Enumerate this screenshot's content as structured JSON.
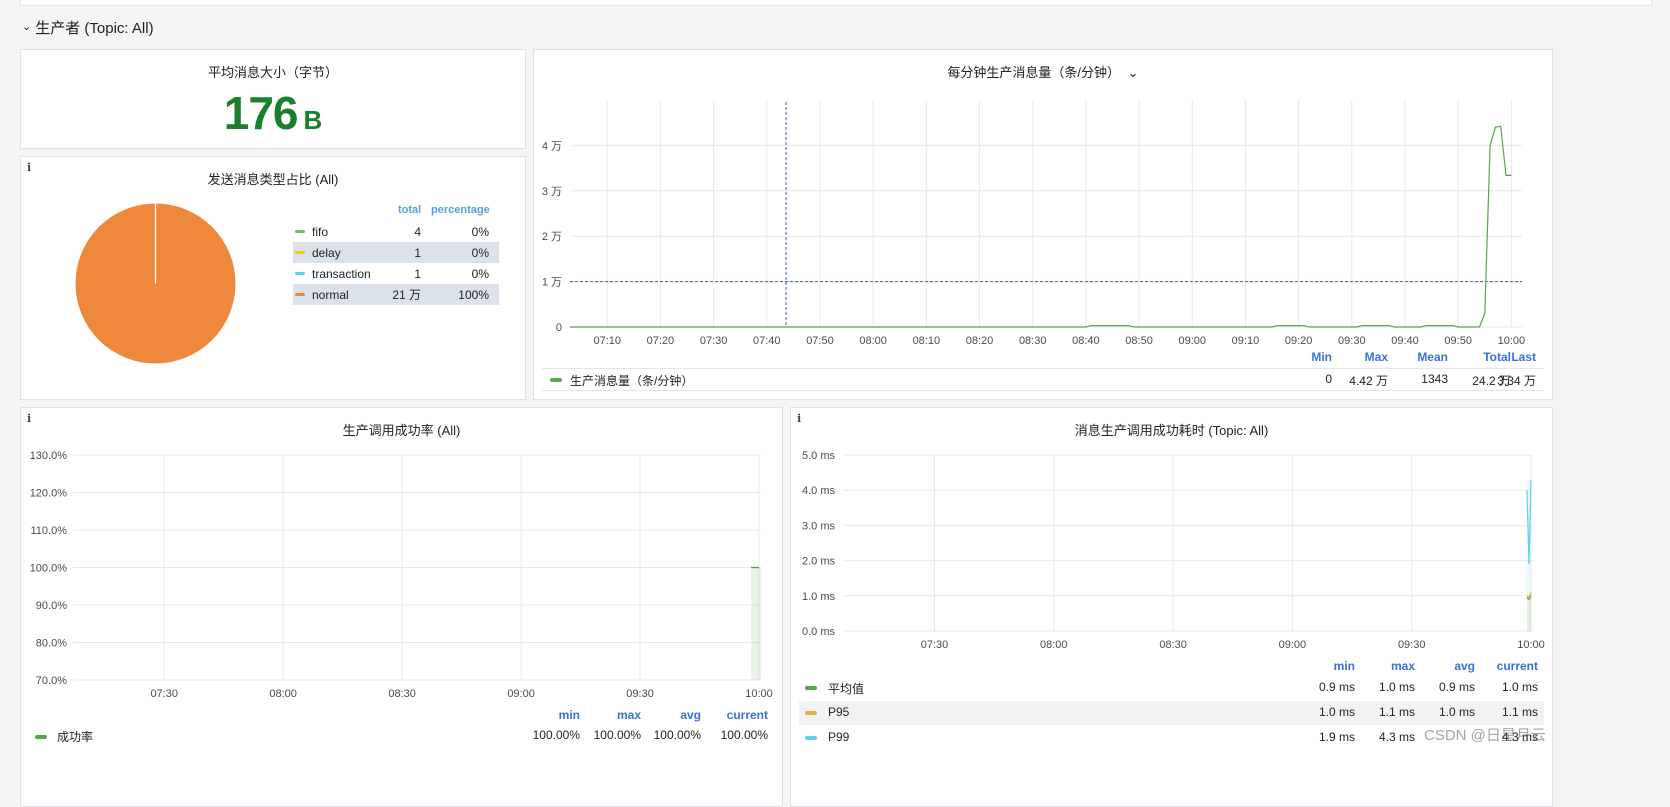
{
  "row": {
    "title": "生产者 (Topic: All)"
  },
  "avg_size": {
    "title": "平均消息大小（字节）",
    "value": "176",
    "unit": "B",
    "color": "#1a7f2b"
  },
  "pie": {
    "title": "发送消息类型占比 (All)",
    "info_icon": "i",
    "headers": {
      "total": "total",
      "percentage": "percentage"
    },
    "rows": [
      {
        "name": "fifo",
        "total": "4",
        "percentage": "0%",
        "color": "#73bf69"
      },
      {
        "name": "delay",
        "total": "1",
        "percentage": "0%",
        "color": "#f2cc0c"
      },
      {
        "name": "transaction",
        "total": "1",
        "percentage": "0%",
        "color": "#5fd1e8"
      },
      {
        "name": "normal",
        "total": "21 万",
        "percentage": "100%",
        "color": "#f0883c"
      }
    ]
  },
  "per_min": {
    "title": "每分钟生产消息量（条/分钟）",
    "chevron": "⌄",
    "legend": {
      "headers": [
        "Min",
        "Max",
        "Mean",
        "Total",
        "Last"
      ],
      "series_name": "生产消息量（条/分钟）",
      "values": [
        "0",
        "4.42 万",
        "1343",
        "24.2 万",
        "3.34 万"
      ]
    }
  },
  "success_rate": {
    "title": "生产调用成功率 (All)",
    "info_icon": "i",
    "legend": {
      "headers": [
        "min",
        "max",
        "avg",
        "current"
      ],
      "series_name": "成功率",
      "values": [
        "100.00%",
        "100.00%",
        "100.00%",
        "100.00%"
      ]
    }
  },
  "latency": {
    "title": "消息生产调用成功耗时 (Topic: All)",
    "info_icon": "i",
    "legend": {
      "headers": [
        "min",
        "max",
        "avg",
        "current"
      ],
      "rows": [
        {
          "name": "平均值",
          "values": [
            "0.9 ms",
            "1.0 ms",
            "0.9 ms",
            "1.0 ms"
          ]
        },
        {
          "name": "P95",
          "values": [
            "1.0 ms",
            "1.1 ms",
            "1.0 ms",
            "1.1 ms"
          ]
        },
        {
          "name": "P99",
          "values": [
            "1.9 ms",
            "4.3 ms",
            "",
            "4.3 ms"
          ]
        }
      ]
    }
  },
  "watermark": "CSDN @日星月云",
  "chart_data": [
    {
      "type": "pie",
      "title": "发送消息类型占比 (All)",
      "categories": [
        "fifo",
        "delay",
        "transaction",
        "normal"
      ],
      "values": [
        4,
        1,
        1,
        210000
      ]
    },
    {
      "type": "line",
      "title": "每分钟生产消息量（条/分钟）",
      "x_ticks": [
        "07:10",
        "07:20",
        "07:30",
        "07:40",
        "07:50",
        "08:00",
        "08:10",
        "08:20",
        "08:30",
        "08:40",
        "08:50",
        "09:00",
        "09:10",
        "09:20",
        "09:30",
        "09:40",
        "09:50",
        "10:00"
      ],
      "y_ticks": [
        "0",
        "1 万",
        "2 万",
        "3 万",
        "4 万"
      ],
      "ylim": [
        0,
        50000
      ],
      "grid": true,
      "series": [
        {
          "name": "生产消息量（条/分钟）",
          "color": "#56a64b",
          "points": [
            [
              "07:03",
              0
            ],
            [
              "08:40",
              0
            ],
            [
              "08:41",
              300
            ],
            [
              "08:48",
              300
            ],
            [
              "08:49",
              0
            ],
            [
              "09:15",
              0
            ],
            [
              "09:16",
              300
            ],
            [
              "09:21",
              300
            ],
            [
              "09:22",
              0
            ],
            [
              "09:31",
              0
            ],
            [
              "09:32",
              300
            ],
            [
              "09:37",
              300
            ],
            [
              "09:38",
              0
            ],
            [
              "09:43",
              0
            ],
            [
              "09:44",
              300
            ],
            [
              "09:49",
              300
            ],
            [
              "09:50",
              0
            ],
            [
              "09:54",
              0
            ],
            [
              "09:55",
              3000
            ],
            [
              "09:56",
              40000
            ],
            [
              "09:57",
              44000
            ],
            [
              "09:58",
              44200
            ],
            [
              "09:59",
              33400
            ],
            [
              "10:00",
              33400
            ]
          ]
        }
      ]
    },
    {
      "type": "line",
      "title": "生产调用成功率 (All)",
      "x_ticks": [
        "07:30",
        "08:00",
        "08:30",
        "09:00",
        "09:30",
        "10:00"
      ],
      "y_ticks": [
        "70.0%",
        "80.0%",
        "90.0%",
        "100.0%",
        "110.0%",
        "120.0%",
        "130.0%"
      ],
      "ylim": [
        70,
        130
      ],
      "grid": true,
      "series": [
        {
          "name": "成功率",
          "color": "#56a64b",
          "points": [
            [
              "09:58",
              100
            ],
            [
              "10:00",
              100
            ]
          ]
        }
      ]
    },
    {
      "type": "line",
      "title": "消息生产调用成功耗时 (Topic: All)",
      "x_ticks": [
        "07:30",
        "08:00",
        "08:30",
        "09:00",
        "09:30",
        "10:00"
      ],
      "y_ticks": [
        "0.0 ms",
        "1.0 ms",
        "2.0 ms",
        "3.0 ms",
        "4.0 ms",
        "5.0 ms"
      ],
      "ylim": [
        0,
        5
      ],
      "grid": true,
      "series": [
        {
          "name": "平均值",
          "color": "#56a64b",
          "points": [
            [
              "09:59",
              0.95
            ],
            [
              "09:59:30",
              0.9
            ],
            [
              "10:00",
              1.0
            ]
          ]
        },
        {
          "name": "P95",
          "color": "#e8b23c",
          "points": [
            [
              "09:59",
              1.0
            ],
            [
              "09:59:30",
              0.95
            ],
            [
              "10:00",
              1.1
            ]
          ]
        },
        {
          "name": "P99",
          "color": "#5fd1e8",
          "points": [
            [
              "09:59",
              4.0
            ],
            [
              "09:59:30",
              1.9
            ],
            [
              "10:00",
              4.3
            ]
          ]
        }
      ]
    }
  ]
}
